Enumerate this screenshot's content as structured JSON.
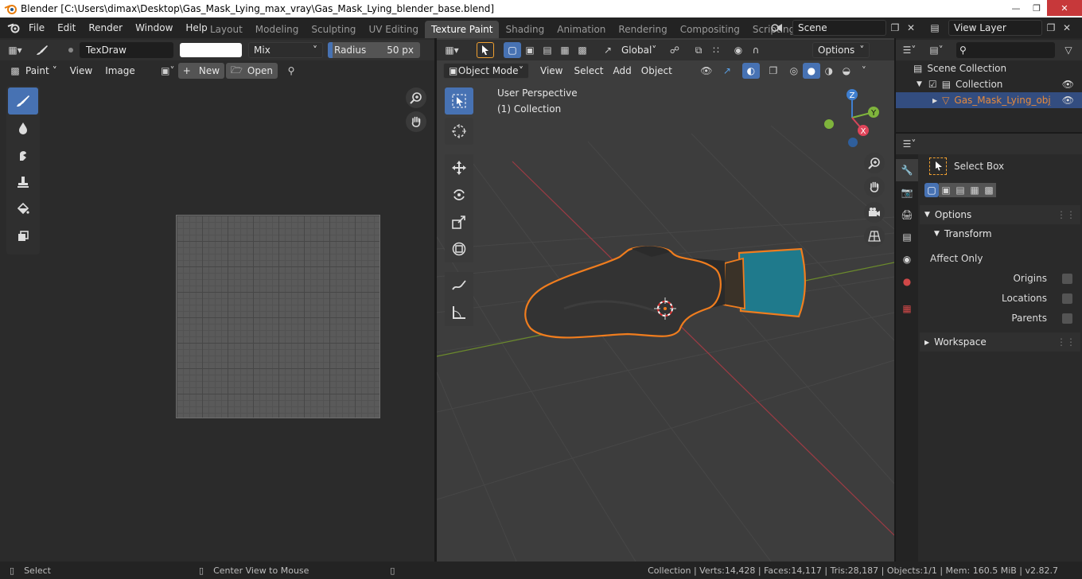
{
  "window": {
    "title": "Blender [C:\\Users\\dimax\\Desktop\\Gas_Mask_Lying_max_vray\\Gas_Mask_Lying_blender_base.blend]"
  },
  "menu": [
    "File",
    "Edit",
    "Render",
    "Window",
    "Help"
  ],
  "workspaces": [
    "Layout",
    "Modeling",
    "Sculpting",
    "UV Editing",
    "Texture Paint",
    "Shading",
    "Animation",
    "Rendering",
    "Compositing",
    "Scripting"
  ],
  "active_workspace": "Texture Paint",
  "scene": {
    "name": "Scene"
  },
  "view_layer": {
    "name": "View Layer"
  },
  "image_editor": {
    "brush_name": "TexDraw",
    "blend_mode": "Mix",
    "radius_label": "Radius",
    "radius_value": "50 px",
    "brush_color": "#ffffff",
    "mode_label": "Paint",
    "menu_view": "View",
    "menu_image": "Image",
    "new_label": "New",
    "open_label": "Open",
    "tools": [
      "draw-brush",
      "soften-brush",
      "smear-brush",
      "clone-brush",
      "fill-brush",
      "mask-brush"
    ]
  },
  "viewport": {
    "mode": "Object Mode",
    "menus": [
      "View",
      "Select",
      "Add",
      "Object"
    ],
    "orientation": "Global",
    "options_label": "Options",
    "perspective_label": "User Perspective",
    "collection_label": "(1) Collection",
    "gizmo": {
      "z": "Z",
      "y": "Y",
      "x": "X"
    }
  },
  "outliner": {
    "scene_collection": "Scene Collection",
    "collection": "Collection",
    "object": "Gas_Mask_Lying_obj_bas"
  },
  "properties": {
    "tool_name": "Select Box",
    "options_label": "Options",
    "transform_label": "Transform",
    "affect_only_label": "Affect Only",
    "origins_label": "Origins",
    "locations_label": "Locations",
    "parents_label": "Parents",
    "workspace_label": "Workspace"
  },
  "statusbar": {
    "select_label": "Select",
    "center_label": "Center View to Mouse",
    "stats": "Collection | Verts:14,428 | Faces:14,117 | Tris:28,187 | Objects:1/1 | Mem: 160.5 MiB | v2.82.7"
  },
  "colors": {
    "accent": "#4772b3",
    "selected_outline": "#f07d1e",
    "object_orange_text": "#e68a3c",
    "axis_x": "#c44d55",
    "axis_y": "#7fa23c"
  }
}
